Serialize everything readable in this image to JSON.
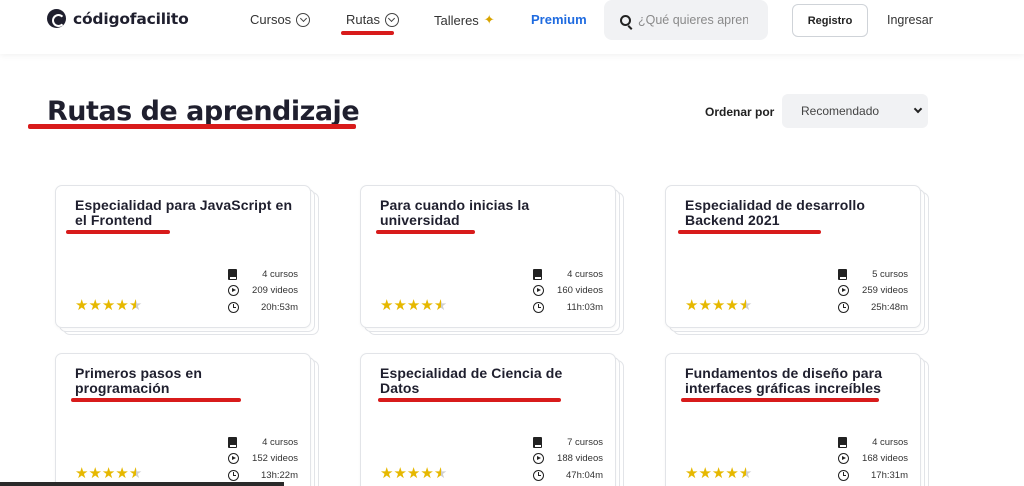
{
  "header": {
    "logo_text": "códigofacilito",
    "nav": {
      "cursos": "Cursos",
      "rutas": "Rutas",
      "talleres": "Talleres",
      "premium": "Premium"
    },
    "search_placeholder": "¿Qué quieres aprender?",
    "registro": "Registro",
    "ingresar": "Ingresar"
  },
  "page": {
    "title": "Rutas de aprendizaje",
    "sort_label": "Ordenar por",
    "sort_value": "Recomendado"
  },
  "cards": [
    {
      "title": "Especialidad para JavaScript en el Frontend",
      "cursos": "4 cursos",
      "videos": "209 videos",
      "duracion": "20h:53m",
      "rating": 4.5
    },
    {
      "title": "Para cuando inicias la universidad",
      "cursos": "4 cursos",
      "videos": "160 videos",
      "duracion": "11h:03m",
      "rating": 4.5
    },
    {
      "title": "Especialidad de desarrollo Backend 2021",
      "cursos": "5 cursos",
      "videos": "259 videos",
      "duracion": "25h:48m",
      "rating": 4.5
    },
    {
      "title": "Primeros pasos en programación",
      "cursos": "4 cursos",
      "videos": "152 videos",
      "duracion": "13h:22m",
      "rating": 4.5
    },
    {
      "title": "Especialidad de Ciencia de Datos",
      "cursos": "7 cursos",
      "videos": "188 videos",
      "duracion": "47h:04m",
      "rating": 4.5
    },
    {
      "title": "Fundamentos de diseño para interfaces gráficas increíbles",
      "cursos": "4 cursos",
      "videos": "168 videos",
      "duracion": "17h:31m",
      "rating": 4.5
    }
  ],
  "colors": {
    "premium": "#1f6be0",
    "annotation_underline": "#d81b1b",
    "star": "#e6b800"
  }
}
